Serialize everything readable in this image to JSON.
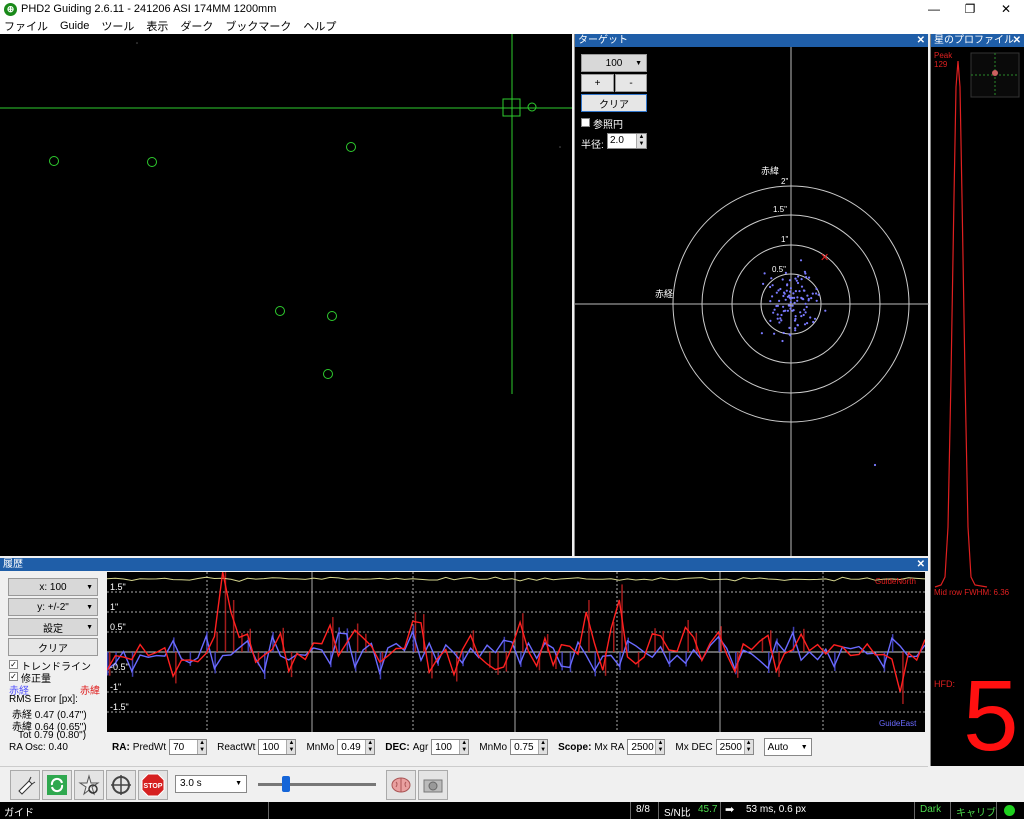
{
  "window": {
    "title": "PHD2 Guiding 2.6.11 - 241206 ASI 174MM  1200mm",
    "app_icon": "phd2-icon",
    "minimize": "—",
    "maximize": "❐",
    "close": "✕"
  },
  "menu": [
    "ファイル",
    "Guide",
    "ツール",
    "表示",
    "ダーク",
    "ブックマーク",
    "ヘルプ"
  ],
  "target_pane": {
    "title": "ターゲット",
    "close": "✕",
    "zoom_value": "100",
    "plus": "+",
    "minus": "-",
    "clear": "クリア",
    "ref_circle_label": "参照円",
    "radius_label": "半径:",
    "radius_value": "2.0",
    "label_top": "赤緯",
    "label_left": "赤経",
    "ring_labels": [
      "2\"",
      "1.5\"",
      "1\"",
      "0.5\""
    ]
  },
  "profile_pane": {
    "title": "星のプロファイル",
    "close": "✕",
    "peak_label": "Peak",
    "peak_value": "129",
    "fwhm_text": "Mid row FWHM: 6.36",
    "hfd_label": "HFD:",
    "hfd_value": "5"
  },
  "history_pane": {
    "title": "履歴",
    "close": "✕",
    "x_scale": "x: 100",
    "y_scale": "y: +/-2\"",
    "settings": "設定",
    "clear": "クリア",
    "trend_label": "トレンドライン",
    "corrections_label": "修正量",
    "legend_ra": "赤経",
    "legend_dec": "赤緯",
    "rms_title": "RMS Error [px]:",
    "rms_ra": "赤経 0.47 (0.47\")",
    "rms_dec": "赤緯 0.64 (0.65\")",
    "rms_tot": "Tot 0.79 (0.80\")",
    "ra_osc": "RA Osc: 0.40",
    "y_labels": [
      "1.5\"",
      "1\"",
      "0.5\"",
      "-0.5\"",
      "-1\"",
      "-1.5\""
    ],
    "guide_north": "GuideNorth",
    "guide_east": "GuideEast",
    "colors": {
      "ra": "#6a6aff",
      "dec": "#ff2020",
      "snr": "#d8d890"
    }
  },
  "algo_controls": {
    "ra_label": "RA:",
    "predwt_label": "PredWt",
    "predwt_value": "70",
    "reactwt_label": "ReactWt",
    "reactwt_value": "100",
    "mnmo_label": "MnMo",
    "mnmo_ra_value": "0.49",
    "dec_label": "DEC:",
    "agr_label": "Agr",
    "agr_value": "100",
    "mnmo_dec_value": "0.75",
    "scope_label": "Scope:",
    "mxra_label": "Mx RA",
    "mxra_value": "2500",
    "mxdec_label": "Mx DEC",
    "mxdec_value": "2500",
    "mode_value": "Auto"
  },
  "toolbar": {
    "exposure_value": "3.0 s",
    "stop_label": "STOP",
    "icons": [
      "usb-connect-icon",
      "loop-icon",
      "star-select-icon",
      "guide-crosshair-icon",
      "stop-icon",
      "brain-icon",
      "camera-icon"
    ]
  },
  "statusbar": {
    "state": "ガイド",
    "star_count": "8/8",
    "snr_label": "S/N比",
    "snr_value": "45.7",
    "guide_pulse": "53 ms, 0.6 px",
    "dark": "Dark",
    "calib": "キャリブ",
    "colors": {
      "green": "#4cd94c",
      "indicator": "#1fd01f"
    }
  }
}
